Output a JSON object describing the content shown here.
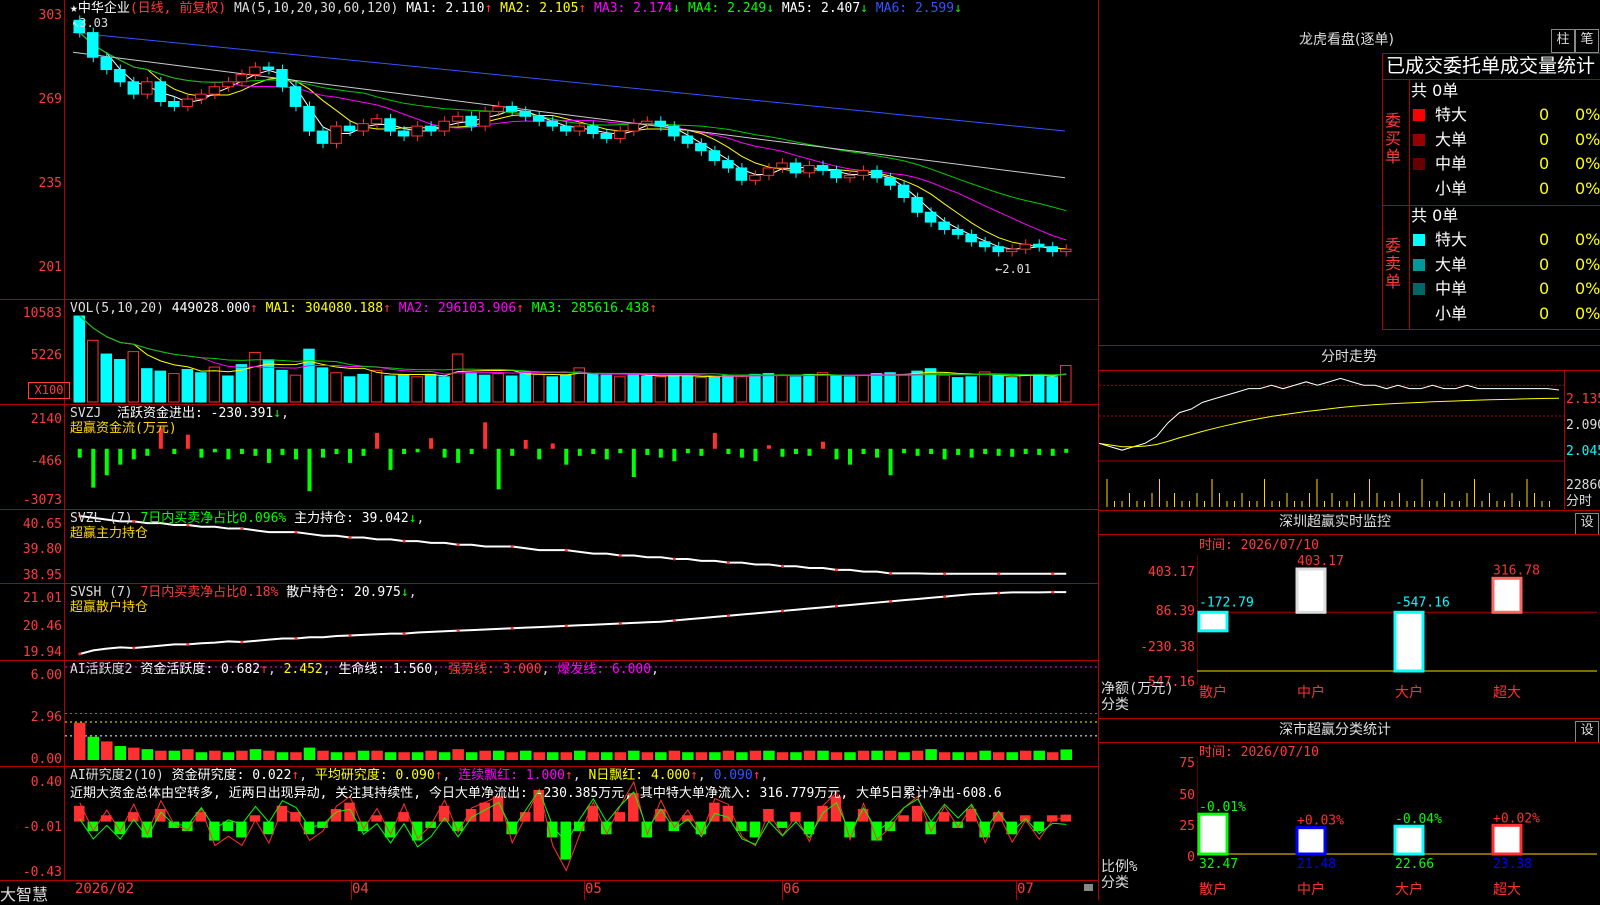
{
  "app": {
    "brand": "大智慧"
  },
  "stock": {
    "name": "中华企业",
    "mode": "(日线, 前复权)"
  },
  "price_panel": {
    "legend": {
      "label": "MA(5,10,20,30,60,120)",
      "items": [
        {
          "name": "MA1:",
          "value": "2.110",
          "arrow": "↑",
          "color": "#ffffff"
        },
        {
          "name": "MA2:",
          "value": "2.105",
          "arrow": "↑",
          "color": "#ffff00"
        },
        {
          "name": "MA3:",
          "value": "2.174",
          "arrow": "↓",
          "color": "#ff00ff"
        },
        {
          "name": "MA4:",
          "value": "2.249",
          "arrow": "↓",
          "color": "#00ff00"
        },
        {
          "name": "MA5:",
          "value": "2.407",
          "arrow": "↓",
          "color": "#ffffff"
        },
        {
          "name": "MA6:",
          "value": "2.599",
          "arrow": "↓",
          "color": "#3355ff"
        }
      ]
    },
    "y_ticks": [
      "303",
      "269",
      "235",
      "201"
    ],
    "high_mark": "3.03",
    "low_mark": "2.01"
  },
  "vol_panel": {
    "legend": {
      "label": "VOL(5,10,20)",
      "value": "449028.000",
      "arrow": "↑",
      "items": [
        {
          "name": "MA1:",
          "value": "304080.188",
          "arrow": "↑",
          "color": "#ffff00"
        },
        {
          "name": "MA2:",
          "value": "296103.906",
          "arrow": "↑",
          "color": "#ff00ff"
        },
        {
          "name": "MA3:",
          "value": "285616.438",
          "arrow": "↑",
          "color": "#00ff00"
        }
      ]
    },
    "y_ticks": [
      "10583",
      "5226"
    ],
    "unit": "X100"
  },
  "svzj_panel": {
    "label": "SVZJ",
    "text": "活跃资金进出: -230.391",
    "arrow": "↓",
    "subtitle": "超赢资金流(万元)",
    "y_ticks": [
      "2140",
      "-466",
      "-3073"
    ]
  },
  "svzl_panel": {
    "label": "SVZL (7)",
    "text1": "7日内买卖净占比0.096%",
    "text2": "主力持仓: 39.042",
    "arrow": "↓",
    "subtitle": "超赢主力持仓",
    "y_ticks": [
      "40.65",
      "39.80",
      "38.95"
    ]
  },
  "svsh_panel": {
    "label": "SVSH (7)",
    "text1": "7日内买卖净占比0.18%",
    "text2": "散户持仓: 20.975",
    "arrow": "↓",
    "subtitle": "超赢散户持仓",
    "y_ticks": [
      "21.01",
      "20.46",
      "19.94"
    ]
  },
  "ai_activity_panel": {
    "label": "AI活跃度2",
    "t1": "资金活跃度: 0.682",
    "t1_arrow": "↑",
    "t2": "2.452",
    "t3": "生命线: 1.560",
    "t4": "强势线: 3.000",
    "t5": "爆发线: 6.000",
    "y_ticks": [
      "6.00",
      "2.96",
      "0.00"
    ]
  },
  "ai_research_panel": {
    "label": "AI研究度2(10)",
    "t1": "资金研究度: 0.022",
    "t2": "平均研究度: 0.090",
    "t3": "连续飘红: 1.000",
    "t4": "N日飘红: 4.000",
    "t5": "0.090",
    "comment": "近期大资金总体由空转多, 近两日出现异动, 关注其持续性, 今日大单净流出: -230.385万元, 其中特大单净流入: 316.779万元, 大单5日累计净出-608.6",
    "y_ticks": [
      "0.40",
      "-0.01",
      "-0.43"
    ]
  },
  "x_axis": {
    "labels": [
      "2026/02",
      "04",
      "05",
      "06",
      "07"
    ]
  },
  "right_panel": {
    "dragon_title": "龙虎看盘(逐单)",
    "btn_bar": "柱",
    "btn_pen": "笔",
    "stats_title": "已成交委托单成交量统计",
    "buy": {
      "side_label": "委买单",
      "total": "共 0单",
      "rows": [
        {
          "label": "特大",
          "count": "0",
          "pct": "0%",
          "color": "#ff0000"
        },
        {
          "label": "大单",
          "count": "0",
          "pct": "0%",
          "color": "#990000"
        },
        {
          "label": "中单",
          "count": "0",
          "pct": "0%",
          "color": "#660000"
        },
        {
          "label": "小单",
          "count": "0",
          "pct": "0%",
          "color": ""
        }
      ]
    },
    "sell": {
      "side_label": "委卖单",
      "total": "共 0单",
      "rows": [
        {
          "label": "特大",
          "count": "0",
          "pct": "0%",
          "color": "#00ffff"
        },
        {
          "label": "大单",
          "count": "0",
          "pct": "0%",
          "color": "#009999"
        },
        {
          "label": "中单",
          "count": "0",
          "pct": "0%",
          "color": "#006666"
        },
        {
          "label": "小单",
          "count": "0",
          "pct": "0%",
          "color": ""
        }
      ]
    },
    "intraday": {
      "title": "分时走势",
      "price_ticks": [
        "2.135",
        "2.090",
        "2.045"
      ],
      "vol_tick": "22860",
      "vol_label": "分时"
    },
    "monitor": {
      "title": "深圳超赢实时监控",
      "btn": "设",
      "time": "时间: 2026/07/10",
      "y_ticks": [
        "403.17",
        "86.39",
        "-230.38",
        "-547.16"
      ],
      "axis_label1": "净额(万元)",
      "axis_label2": "分类"
    },
    "classify": {
      "title": "深市超赢分类统计",
      "btn": "设",
      "time": "时间: 2026/07/10",
      "y_ticks": [
        "75",
        "50",
        "25",
        "0"
      ],
      "axis_label1": "比例%",
      "axis_label2": "分类"
    }
  },
  "chart_data": [
    {
      "type": "candlestick",
      "title": "中华企业",
      "ylim": [
        1.95,
        3.1
      ],
      "dates": [
        "2026/02",
        "04",
        "05",
        "06",
        "07"
      ],
      "close": [
        3.0,
        2.9,
        2.85,
        2.8,
        2.75,
        2.8,
        2.72,
        2.7,
        2.73,
        2.75,
        2.78,
        2.8,
        2.83,
        2.86,
        2.85,
        2.78,
        2.7,
        2.6,
        2.55,
        2.62,
        2.6,
        2.63,
        2.65,
        2.6,
        2.58,
        2.62,
        2.6,
        2.64,
        2.66,
        2.62,
        2.68,
        2.7,
        2.68,
        2.66,
        2.64,
        2.62,
        2.6,
        2.62,
        2.59,
        2.57,
        2.6,
        2.63,
        2.64,
        2.62,
        2.58,
        2.55,
        2.52,
        2.48,
        2.45,
        2.4,
        2.42,
        2.45,
        2.47,
        2.43,
        2.46,
        2.44,
        2.41,
        2.42,
        2.44,
        2.41,
        2.38,
        2.33,
        2.27,
        2.23,
        2.2,
        2.18,
        2.15,
        2.13,
        2.11,
        2.12,
        2.14,
        2.13,
        2.11,
        2.12
      ]
    },
    {
      "type": "bar",
      "title": "VOL(5,10,20)",
      "ylim": [
        0,
        10583
      ],
      "values": [
        10583,
        7600,
        5900,
        5226,
        6200,
        4100,
        3800,
        3500,
        4000,
        3600,
        4300,
        3200,
        4600,
        6100,
        5200,
        3900,
        3300,
        6500,
        4200,
        3600,
        3100,
        3400,
        3900,
        3200,
        3300,
        3100,
        3400,
        3100,
        5900,
        3600,
        3300,
        3500,
        3200,
        3700,
        3400,
        3100,
        3300,
        4200,
        3500,
        3300,
        3100,
        3400,
        3200,
        3100,
        3300,
        3200,
        3000,
        3100,
        3300,
        3200,
        3400,
        3500,
        3300,
        3100,
        3400,
        3600,
        3200,
        3100,
        3300,
        3500,
        3600,
        3400,
        3800,
        4100,
        3300,
        3000,
        3100,
        3700,
        3200,
        3000,
        3300,
        3400,
        3100,
        4490
      ]
    },
    {
      "type": "bar",
      "title": "超赢资金流(万元)",
      "ylim": [
        -3073,
        2140
      ],
      "values": [
        -500,
        -2200,
        -1500,
        -900,
        -600,
        -400,
        1200,
        -300,
        800,
        -500,
        -200,
        -600,
        -300,
        -400,
        -800,
        -350,
        -600,
        -2400,
        -500,
        -300,
        -800,
        -400,
        900,
        -1200,
        -300,
        -200,
        600,
        -500,
        -800,
        -300,
        1500,
        -2300,
        -400,
        500,
        -600,
        300,
        -900,
        -400,
        -300,
        -600,
        -250,
        -1600,
        -350,
        -500,
        -700,
        -250,
        -400,
        900,
        -300,
        -500,
        -700,
        200,
        -450,
        -300,
        -400,
        400,
        -600,
        -900,
        -300,
        -500,
        -1500,
        -250,
        -400,
        -300,
        -600,
        -350,
        -500,
        -300,
        -400,
        -450,
        -300,
        -350,
        -400,
        -230
      ]
    },
    {
      "type": "line",
      "title": "超赢主力持仓",
      "ylim": [
        38.95,
        40.65
      ],
      "values": [
        40.65,
        40.6,
        40.55,
        40.5,
        40.5,
        40.45,
        40.45,
        40.4,
        40.4,
        40.35,
        40.35,
        40.3,
        40.3,
        40.25,
        40.2,
        40.2,
        40.2,
        40.15,
        40.1,
        40.1,
        40.05,
        40.05,
        40.0,
        40.0,
        39.95,
        39.95,
        39.9,
        39.9,
        39.85,
        39.85,
        39.8,
        39.8,
        39.8,
        39.75,
        39.7,
        39.7,
        39.7,
        39.65,
        39.6,
        39.6,
        39.55,
        39.55,
        39.5,
        39.5,
        39.45,
        39.45,
        39.4,
        39.4,
        39.35,
        39.35,
        39.3,
        39.3,
        39.25,
        39.25,
        39.2,
        39.2,
        39.15,
        39.15,
        39.1,
        39.1,
        39.05,
        39.05,
        39.05,
        39.04,
        39.04,
        39.04,
        39.04,
        39.04,
        39.04,
        39.04,
        39.04,
        39.04,
        39.04,
        39.04
      ]
    },
    {
      "type": "line",
      "title": "超赢散户持仓",
      "ylim": [
        19.94,
        21.01
      ],
      "values": [
        19.94,
        20.0,
        20.03,
        20.05,
        20.04,
        20.06,
        20.08,
        20.1,
        20.1,
        20.12,
        20.13,
        20.15,
        20.14,
        20.16,
        20.18,
        20.2,
        20.2,
        20.22,
        20.22,
        20.24,
        20.25,
        20.26,
        20.27,
        20.28,
        20.28,
        20.3,
        20.31,
        20.32,
        20.33,
        20.34,
        20.35,
        20.36,
        20.37,
        20.38,
        20.39,
        20.4,
        20.41,
        20.42,
        20.43,
        20.44,
        20.45,
        20.46,
        20.47,
        20.48,
        20.5,
        20.52,
        20.54,
        20.56,
        20.58,
        20.6,
        20.62,
        20.64,
        20.66,
        20.68,
        20.7,
        20.72,
        20.74,
        20.76,
        20.78,
        20.8,
        20.82,
        20.84,
        20.86,
        20.88,
        20.9,
        20.92,
        20.94,
        20.95,
        20.96,
        20.97,
        20.97,
        20.97,
        20.975,
        20.975
      ]
    },
    {
      "type": "bar",
      "title": "AI活跃度2",
      "ylim": [
        0,
        6
      ],
      "values": [
        2.4,
        1.5,
        1.2,
        0.9,
        0.8,
        0.7,
        0.6,
        0.6,
        0.7,
        0.5,
        0.6,
        0.5,
        0.6,
        0.7,
        0.6,
        0.5,
        0.5,
        0.8,
        0.6,
        0.5,
        0.5,
        0.6,
        0.6,
        0.5,
        0.5,
        0.5,
        0.6,
        0.5,
        0.7,
        0.5,
        0.6,
        0.6,
        0.5,
        0.6,
        0.5,
        0.5,
        0.5,
        0.6,
        0.5,
        0.5,
        0.5,
        0.6,
        0.5,
        0.5,
        0.6,
        0.5,
        0.5,
        0.5,
        0.6,
        0.5,
        0.6,
        0.6,
        0.5,
        0.5,
        0.6,
        0.6,
        0.5,
        0.5,
        0.6,
        0.6,
        0.6,
        0.5,
        0.6,
        0.7,
        0.5,
        0.5,
        0.5,
        0.6,
        0.5,
        0.5,
        0.6,
        0.6,
        0.5,
        0.68
      ]
    },
    {
      "type": "bar",
      "title": "AI研究度2(10)",
      "ylim": [
        -0.43,
        0.4
      ],
      "values": [
        0.05,
        -0.03,
        0.02,
        -0.04,
        0.03,
        -0.05,
        0.04,
        -0.02,
        -0.03,
        0.03,
        -0.06,
        -0.03,
        -0.05,
        0.02,
        -0.04,
        0.05,
        0.03,
        -0.04,
        -0.02,
        0.04,
        0.06,
        -0.03,
        0.02,
        -0.05,
        0.03,
        -0.06,
        -0.02,
        0.05,
        -0.03,
        0.04,
        0.06,
        0.08,
        -0.04,
        0.03,
        0.1,
        -0.05,
        -0.12,
        -0.03,
        0.05,
        -0.04,
        0.03,
        0.09,
        -0.05,
        0.04,
        -0.03,
        0.02,
        -0.04,
        0.06,
        0.05,
        -0.03,
        -0.05,
        0.04,
        -0.02,
        0.03,
        -0.04,
        0.05,
        0.08,
        -0.05,
        0.04,
        -0.06,
        -0.03,
        0.02,
        0.05,
        -0.04,
        0.03,
        -0.02,
        0.04,
        -0.05,
        0.03,
        -0.04,
        0.02,
        -0.03,
        0.02,
        0.022
      ]
    },
    {
      "type": "line",
      "title": "分时走势",
      "ylim": [
        2.03,
        2.15
      ],
      "values": [
        2.05,
        2.045,
        2.04,
        2.045,
        2.05,
        2.06,
        2.08,
        2.095,
        2.1,
        2.11,
        2.115,
        2.12,
        2.125,
        2.13,
        2.13,
        2.135,
        2.13,
        2.135,
        2.14,
        2.135,
        2.14,
        2.145,
        2.14,
        2.135,
        2.135,
        2.13,
        2.135,
        2.13,
        2.13,
        2.135,
        2.13,
        2.13,
        2.135,
        2.13,
        2.13,
        2.13,
        2.13,
        2.13,
        2.13,
        2.13,
        2.128
      ]
    },
    {
      "type": "bar",
      "title": "深圳超赢实时监控",
      "ylim": [
        -547.16,
        403.17
      ],
      "categories": [
        "散户",
        "中户",
        "大户",
        "超大"
      ],
      "values": [
        -172.79,
        403.17,
        -547.16,
        316.78
      ]
    },
    {
      "type": "bar",
      "title": "深市超赢分类统计",
      "ylim": [
        0,
        75
      ],
      "categories": [
        "散户",
        "中户",
        "大户",
        "超大"
      ],
      "values": [
        32.47,
        21.48,
        22.66,
        23.38
      ],
      "changes": [
        "-0.01%",
        "+0.03%",
        "-0.04%",
        "+0.02%"
      ]
    }
  ]
}
